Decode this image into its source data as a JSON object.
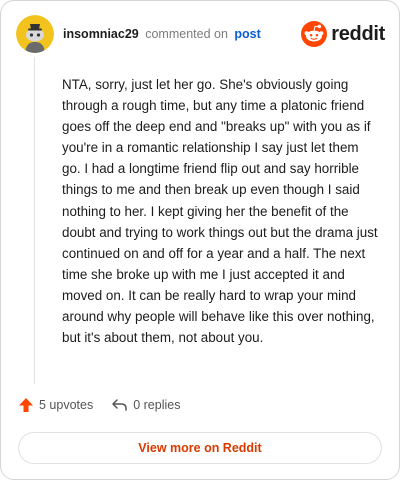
{
  "header": {
    "username": "insomniac29",
    "action_text": "commented on",
    "post_link": "post",
    "brand_name": "reddit"
  },
  "comment": {
    "body": "NTA, sorry, just let her go. She's obviously going through a rough time, but any time a platonic friend goes off the deep end and \"breaks up\" with you as if you're in a romantic relationship I say just let them go. I had a longtime friend flip out and say horrible things to me and then break up even though I said nothing to her. I kept giving her the benefit of the doubt and trying to work things out but the drama just continued on and off for a year and a half. The next time she broke up with me I just accepted it and moved on. It can be really hard to wrap your mind around why people will behave like this over nothing, but it's about them, not about you."
  },
  "actions": {
    "upvotes_label": "5 upvotes",
    "replies_label": "0 replies"
  },
  "footer": {
    "view_more_label": "View more on Reddit"
  },
  "icons": {
    "avatar": "snoo-avatar-icon",
    "brand": "reddit-logo-icon",
    "upvote": "upvote-arrow-icon",
    "reply": "reply-arrow-icon"
  },
  "colors": {
    "brand_orange": "#ff4500",
    "upvote": "#ff4500",
    "link_blue": "#0a5ed7",
    "view_more_text": "#d93a00",
    "avatar_yellow": "#f2c21d"
  }
}
